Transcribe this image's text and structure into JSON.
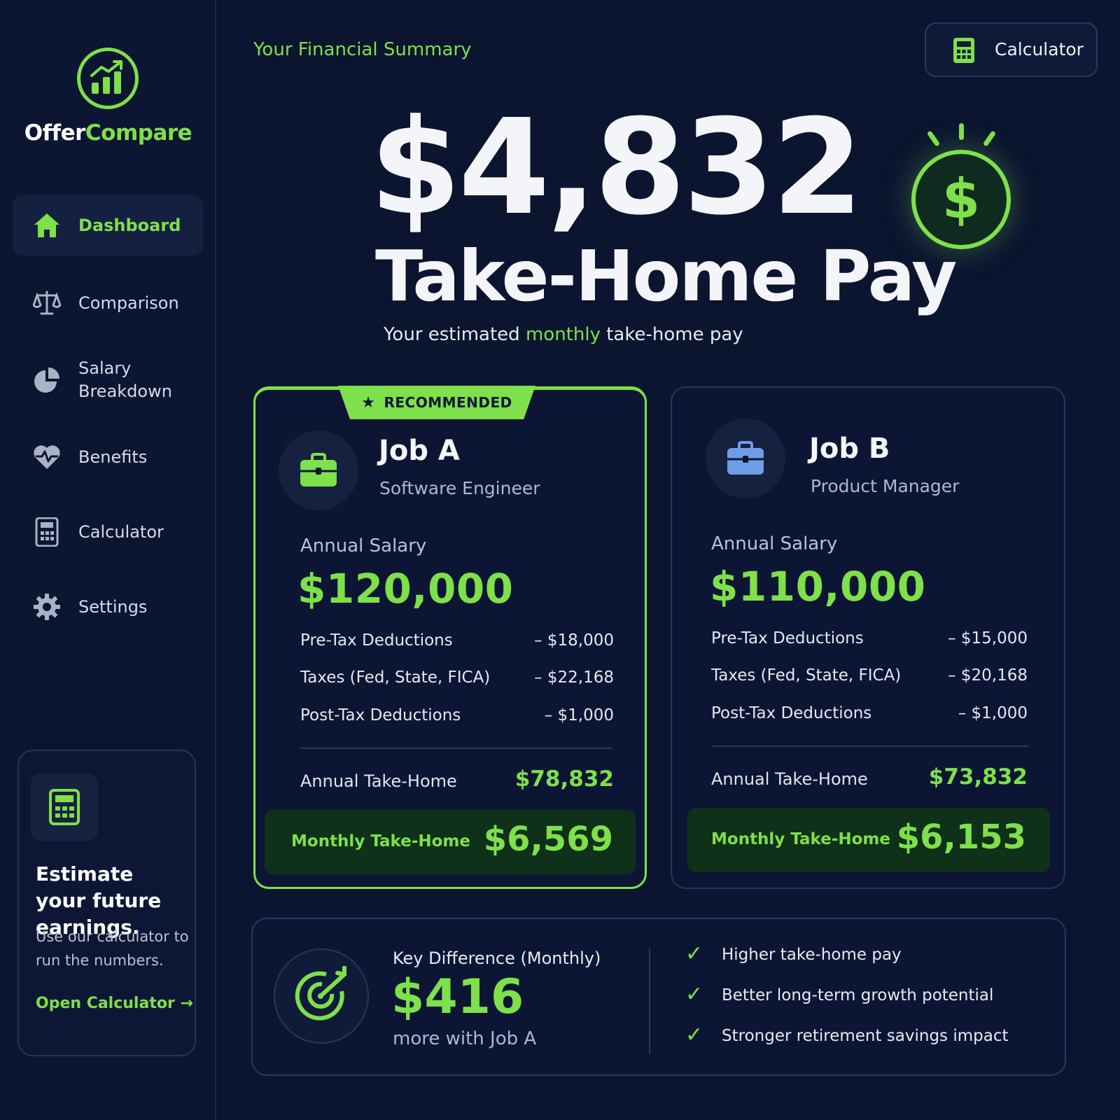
{
  "app": {
    "logo_part1": "Offer",
    "logo_part2": "Compare"
  },
  "sidebar": {
    "items": [
      {
        "label": "Dashboard",
        "icon": "home-icon",
        "active": true
      },
      {
        "label": "Comparison",
        "icon": "scale-icon",
        "active": false
      },
      {
        "label": "Salary Breakdown",
        "icon": "pie-chart-icon",
        "active": false
      },
      {
        "label": "Benefits",
        "icon": "heart-pulse-icon",
        "active": false
      },
      {
        "label": "Calculator",
        "icon": "calculator-icon",
        "active": false
      },
      {
        "label": "Settings",
        "icon": "gear-icon",
        "active": false
      }
    ],
    "promo": {
      "title": "Estimate your future earnings.",
      "text": "Use our calculator to run the numbers.",
      "link": "Open Calculator →"
    }
  },
  "header": {
    "section_label": "Your Financial Summary",
    "calculator_button": "Calculator"
  },
  "hero": {
    "amount": "$4,832",
    "title": "Take-Home Pay",
    "subtitle_pre": "Your estimated ",
    "subtitle_highlight": "monthly",
    "subtitle_post": " take-home pay",
    "dollar_glyph": "$"
  },
  "jobs": [
    {
      "badge": "RECOMMENDED",
      "name": "Job A",
      "role": "Software Engineer",
      "salary_label": "Annual Salary",
      "salary": "$120,000",
      "rows": [
        {
          "label": "Pre-Tax Deductions",
          "value": "– $18,000"
        },
        {
          "label": "Taxes (Fed, State, FICA)",
          "value": "– $22,168"
        },
        {
          "label": "Post-Tax Deductions",
          "value": "– $1,000"
        }
      ],
      "annual_label": "Annual Take-Home",
      "annual_value": "$78,832",
      "monthly_label": "Monthly Take-Home",
      "monthly_value": "$6,569"
    },
    {
      "name": "Job B",
      "role": "Product Manager",
      "salary_label": "Annual Salary",
      "salary": "$110,000",
      "rows": [
        {
          "label": "Pre-Tax Deductions",
          "value": "– $15,000"
        },
        {
          "label": "Taxes (Fed, State, FICA)",
          "value": "– $20,168"
        },
        {
          "label": "Post-Tax Deductions",
          "value": "– $1,000"
        }
      ],
      "annual_label": "Annual Take-Home",
      "annual_value": "$73,832",
      "monthly_label": "Monthly Take-Home",
      "monthly_value": "$6,153"
    }
  ],
  "difference": {
    "label": "Key Difference (Monthly)",
    "value": "$416",
    "sub": "more with Job A",
    "bullets": [
      "Higher take-home pay",
      "Better long-term growth potential",
      "Stronger retirement savings impact"
    ]
  },
  "colors": {
    "background": "#0b1530",
    "accent": "#7ee04a",
    "job_b_icon": "#6f9ee8"
  }
}
